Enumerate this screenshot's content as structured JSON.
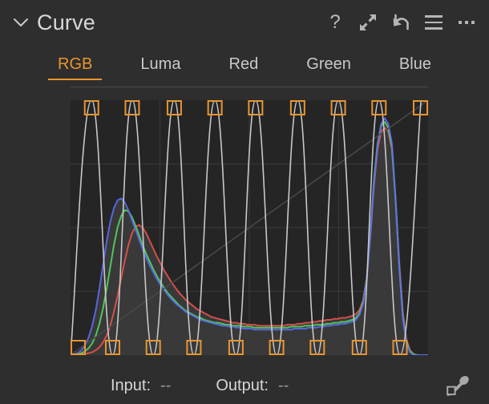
{
  "panel": {
    "title": "Curve",
    "collapse_icon": "chevron-down-icon"
  },
  "header_tools": [
    {
      "name": "help-icon",
      "label": "?"
    },
    {
      "name": "expand-icon",
      "label": ""
    },
    {
      "name": "undo-icon",
      "label": ""
    },
    {
      "name": "menu-icon",
      "label": ""
    },
    {
      "name": "more-options-icon",
      "label": ""
    }
  ],
  "tabs": [
    {
      "label": "RGB",
      "active": true
    },
    {
      "label": "Luma",
      "active": false
    },
    {
      "label": "Red",
      "active": false
    },
    {
      "label": "Green",
      "active": false
    },
    {
      "label": "Blue",
      "active": false
    }
  ],
  "footer": {
    "input_label": "Input:",
    "input_value": "--",
    "output_label": "Output:",
    "output_value": "--",
    "picker_icon": "eyedropper-icon"
  },
  "colors": {
    "accent": "#e8952f",
    "panel_bg": "#2e2e2e",
    "graph_bg": "#252525",
    "text": "#d6d6d6",
    "text_dim": "#9a9a9a",
    "curve": "#c8c8c8",
    "grid": "#3a3a3a",
    "control_point": "#e8952f",
    "hist_red": "#e8524f",
    "hist_green": "#55d45e",
    "hist_blue": "#5b6ef0",
    "hist_fill": "#3d3d3d"
  },
  "chart_data": {
    "type": "line",
    "title": "Curve",
    "xlabel": "Input",
    "ylabel": "Output",
    "xlim": [
      0,
      255
    ],
    "ylim": [
      0,
      255
    ],
    "grid": true,
    "legend": "none",
    "annotations": [
      "Zig-zag tone curve with 18 control points alternating between top (output 255) and bottom (output 0)",
      "RGB histogram overlay shown behind the curve"
    ],
    "series": [
      {
        "name": "Tone Curve",
        "color": "#c8c8c8",
        "kind": "curve",
        "control_points": [
          {
            "input": 0,
            "output": 0
          },
          {
            "input": 15,
            "output": 255
          },
          {
            "input": 30,
            "output": 0
          },
          {
            "input": 44,
            "output": 255
          },
          {
            "input": 59,
            "output": 0
          },
          {
            "input": 74,
            "output": 255
          },
          {
            "input": 88,
            "output": 0
          },
          {
            "input": 103,
            "output": 255
          },
          {
            "input": 118,
            "output": 0
          },
          {
            "input": 132,
            "output": 255
          },
          {
            "input": 147,
            "output": 0
          },
          {
            "input": 162,
            "output": 255
          },
          {
            "input": 176,
            "output": 0
          },
          {
            "input": 191,
            "output": 255
          },
          {
            "input": 206,
            "output": 0
          },
          {
            "input": 220,
            "output": 255
          },
          {
            "input": 235,
            "output": 0
          },
          {
            "input": 250,
            "output": 255
          }
        ]
      },
      {
        "name": "Identity Reference",
        "color": "#4a4a4a",
        "kind": "diagonal",
        "points": [
          [
            0,
            0
          ],
          [
            255,
            255
          ]
        ]
      },
      {
        "name": "Red Channel Histogram",
        "color": "#e8524f",
        "kind": "histogram",
        "values": [
          0,
          0,
          0,
          1,
          1,
          2,
          3,
          5,
          8,
          13,
          20,
          30,
          44,
          60,
          78,
          96,
          112,
          124,
          131,
          133,
          130,
          124,
          116,
          108,
          100,
          93,
          86,
          80,
          74,
          69,
          64,
          60,
          56,
          53,
          50,
          47,
          45,
          43,
          41,
          39,
          38,
          37,
          36,
          35,
          34,
          33,
          33,
          32,
          32,
          31,
          31,
          31,
          30,
          30,
          30,
          30,
          30,
          30,
          30,
          30,
          31,
          31,
          31,
          32,
          32,
          33,
          33,
          34,
          34,
          35,
          35,
          36,
          36,
          37,
          37,
          38,
          38,
          39,
          40,
          42,
          46,
          56,
          78,
          120,
          172,
          210,
          228,
          232,
          228,
          210,
          160,
          96,
          44,
          16,
          5,
          1,
          0,
          0,
          0,
          0
        ]
      },
      {
        "name": "Green Channel Histogram",
        "color": "#55d45e",
        "kind": "histogram",
        "values": [
          0,
          0,
          1,
          2,
          4,
          7,
          12,
          20,
          32,
          48,
          68,
          90,
          112,
          130,
          142,
          148,
          147,
          141,
          132,
          122,
          112,
          103,
          95,
          87,
          80,
          74,
          68,
          63,
          59,
          55,
          51,
          48,
          45,
          43,
          41,
          39,
          38,
          36,
          35,
          34,
          33,
          33,
          32,
          31,
          31,
          30,
          30,
          30,
          29,
          29,
          29,
          28,
          28,
          28,
          28,
          28,
          28,
          28,
          28,
          28,
          28,
          29,
          29,
          29,
          29,
          30,
          30,
          30,
          31,
          31,
          31,
          32,
          32,
          33,
          33,
          34,
          34,
          35,
          36,
          38,
          43,
          54,
          78,
          124,
          178,
          216,
          234,
          238,
          232,
          212,
          158,
          92,
          40,
          14,
          4,
          1,
          0,
          0,
          0,
          0
        ]
      },
      {
        "name": "Blue Channel Histogram",
        "color": "#5b6ef0",
        "kind": "histogram",
        "values": [
          0,
          1,
          2,
          5,
          10,
          18,
          30,
          46,
          68,
          92,
          116,
          136,
          150,
          158,
          160,
          156,
          148,
          138,
          128,
          118,
          108,
          99,
          91,
          84,
          77,
          71,
          66,
          61,
          57,
          53,
          50,
          47,
          44,
          42,
          40,
          38,
          36,
          35,
          34,
          33,
          32,
          31,
          30,
          30,
          29,
          29,
          28,
          28,
          27,
          27,
          27,
          26,
          26,
          26,
          26,
          26,
          26,
          26,
          26,
          26,
          26,
          26,
          27,
          27,
          27,
          27,
          28,
          28,
          28,
          29,
          29,
          30,
          30,
          31,
          31,
          32,
          32,
          33,
          34,
          36,
          41,
          52,
          76,
          122,
          176,
          214,
          236,
          242,
          236,
          216,
          160,
          92,
          38,
          12,
          3,
          0,
          0,
          0,
          0,
          0
        ]
      }
    ]
  }
}
